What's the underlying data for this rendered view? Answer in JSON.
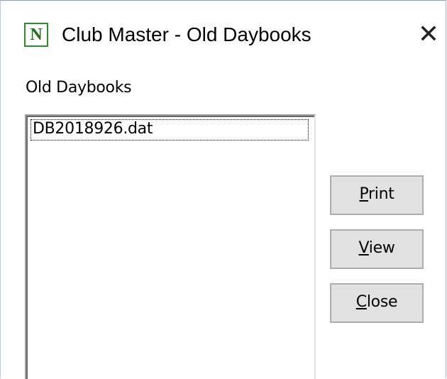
{
  "window": {
    "title": "Club Master - Old Daybooks",
    "icon_letter": "N",
    "icon": "app-n-icon",
    "close_glyph": "✕",
    "accent_color": "#2e8b2e"
  },
  "section_label": "Old Daybooks",
  "daybooks": {
    "items": [
      "DB2018926.dat"
    ],
    "selected": "DB2018926.dat"
  },
  "buttons": {
    "print": {
      "mnemonic": "P",
      "rest": "rint"
    },
    "view": {
      "mnemonic": "V",
      "rest": "iew"
    },
    "close": {
      "mnemonic": "C",
      "rest": "lose"
    }
  }
}
